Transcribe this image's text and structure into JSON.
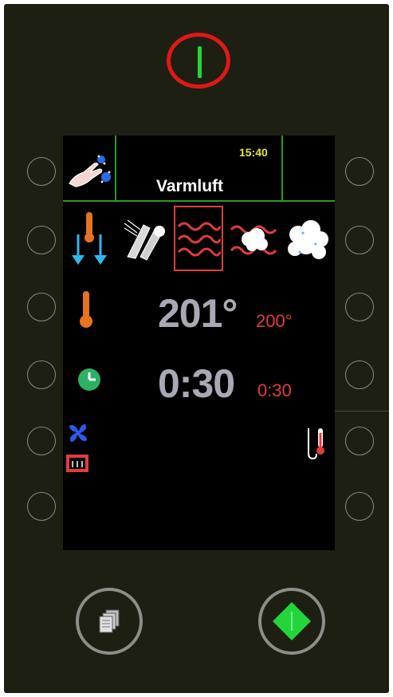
{
  "header": {
    "time": "15:40",
    "program_name": "Varmluft"
  },
  "readouts": {
    "actual_temperature": "201°",
    "set_temperature": "200°",
    "actual_time": "0:30",
    "set_time": "0:30"
  },
  "modes": [
    {
      "name": "cooling",
      "selected": false
    },
    {
      "name": "cleaning",
      "selected": false
    },
    {
      "name": "convection",
      "selected": true
    },
    {
      "name": "combi",
      "selected": false
    },
    {
      "name": "steam",
      "selected": false
    }
  ],
  "colors": {
    "accent_green": "#2b9a2e",
    "set_value_red": "#e23c3c",
    "time_yellow": "#e8e82a",
    "selection_frame": "#e23c3c"
  }
}
